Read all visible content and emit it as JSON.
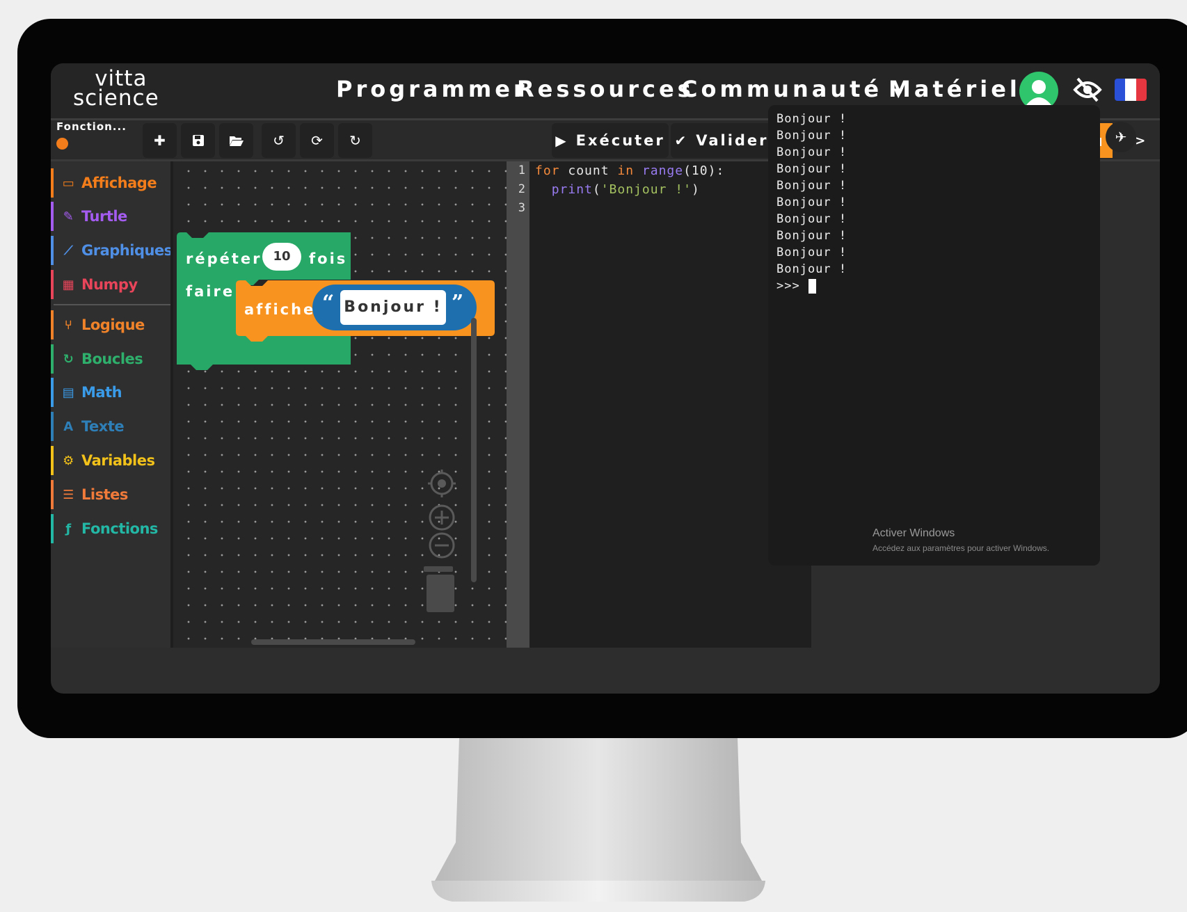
{
  "brand": {
    "line1": "vitta",
    "line2": "science"
  },
  "nav": {
    "programmer": "Programmer",
    "ressources": "Ressources",
    "communaute": "Communauté",
    "materiel": "Matériel"
  },
  "project": {
    "name": "Fonction..."
  },
  "toolbar": {
    "run_label": "Exécuter",
    "validate_label": "Valider"
  },
  "categories": [
    {
      "label": "Affichage",
      "color": "#f27d1a",
      "icon": "monitor-icon"
    },
    {
      "label": "Turtle",
      "color": "#a45cf0",
      "icon": "pencil-icon"
    },
    {
      "label": "Graphiques",
      "color": "#4f8fe6",
      "icon": "chart-icon"
    },
    {
      "label": "Numpy",
      "color": "#e8445a",
      "icon": "grid-icon"
    },
    {
      "label": "Logique",
      "color": "#f0832a",
      "icon": "branch-icon"
    },
    {
      "label": "Boucles",
      "color": "#2eb06c",
      "icon": "loop-icon"
    },
    {
      "label": "Math",
      "color": "#3a9be8",
      "icon": "calculator-icon"
    },
    {
      "label": "Texte",
      "color": "#2e7fb8",
      "icon": "text-icon"
    },
    {
      "label": "Variables",
      "color": "#f2c21a",
      "icon": "gear-icon"
    },
    {
      "label": "Listes",
      "color": "#f07a3a",
      "icon": "list-icon"
    },
    {
      "label": "Fonctions",
      "color": "#23b7a6",
      "icon": "function-icon"
    }
  ],
  "blocks": {
    "repeat_label": "répéter",
    "repeat_count": "10",
    "times_label": "fois",
    "do_label": "faire",
    "print_label": "afficher",
    "open_quote": "“",
    "string_value": "Bonjour !",
    "close_quote": "”"
  },
  "code": {
    "line_numbers": [
      "1",
      "2",
      "3"
    ],
    "line1": {
      "kw_for": "for",
      "var": " count ",
      "kw_in": "in",
      "sp": " ",
      "fn": "range",
      "rest": "(10):"
    },
    "line2": {
      "indent": "  ",
      "fn": "print",
      "open": "(",
      "str": "'Bonjour !'",
      "close": ")"
    }
  },
  "console": {
    "lines": [
      "Bonjour !",
      "Bonjour !",
      "Bonjour !",
      "Bonjour !",
      "Bonjour !",
      "Bonjour !",
      "Bonjour !",
      "Bonjour !",
      "Bonjour !",
      "Bonjour !"
    ],
    "prompt": ">>>"
  },
  "watermark": {
    "title": "Activer Windows",
    "subtitle": "Accédez aux paramètres pour activer Windows."
  },
  "colors": {
    "accent": "#f7931e",
    "loop_block": "#27a866",
    "print_block": "#f7931e",
    "string_block": "#1d6fae",
    "avatar": "#2ec56c"
  }
}
